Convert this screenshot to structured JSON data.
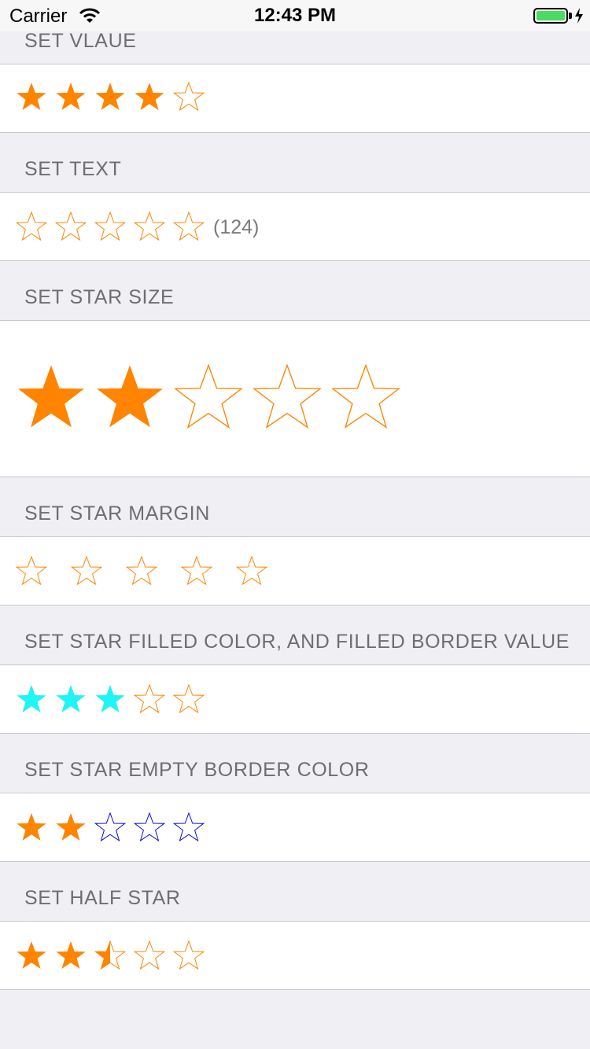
{
  "status_bar": {
    "carrier": "Carrier",
    "time": "12:43 PM"
  },
  "colors": {
    "filled": "#ff8400",
    "empty_border": "#ff8400",
    "cyan_filled": "#1ff5f5",
    "blue_empty_border": "#0a0adc"
  },
  "sections": [
    {
      "title": "SET VLAUE",
      "rating": 4,
      "max": 5
    },
    {
      "title": "SET TEXT",
      "rating": 0,
      "max": 5,
      "text": "(124)"
    },
    {
      "title": "SET STAR SIZE",
      "rating": 2,
      "max": 5
    },
    {
      "title": "SET STAR MARGIN",
      "rating": 0,
      "max": 5
    },
    {
      "title": "SET STAR FILLED COLOR, AND FILLED BORDER VALUE",
      "rating": 3,
      "max": 5
    },
    {
      "title": "SET STAR EMPTY BORDER COLOR",
      "rating": 2,
      "max": 5
    },
    {
      "title": "SET HALF STAR",
      "rating": 2.5,
      "max": 5
    }
  ]
}
